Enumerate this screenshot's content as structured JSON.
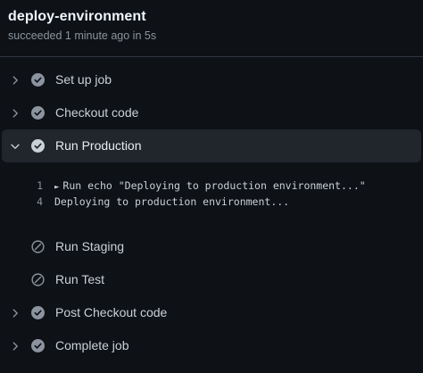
{
  "job": {
    "title": "deploy-environment",
    "status": "succeeded 1 minute ago in 5s"
  },
  "steps": [
    {
      "label": "Set up job",
      "state": "success",
      "expanded": false
    },
    {
      "label": "Checkout code",
      "state": "success",
      "expanded": false
    },
    {
      "label": "Run Production",
      "state": "success",
      "expanded": true
    },
    {
      "label": "Run Staging",
      "state": "skipped",
      "expanded": false
    },
    {
      "label": "Run Test",
      "state": "skipped",
      "expanded": false
    },
    {
      "label": "Post Checkout code",
      "state": "success",
      "expanded": false
    },
    {
      "label": "Complete job",
      "state": "success",
      "expanded": false
    }
  ],
  "log": {
    "lines": [
      {
        "number": "1",
        "group_marker": "►",
        "text": "Run echo \"Deploying to production environment...\""
      },
      {
        "number": "4",
        "text": "Deploying to production environment..."
      }
    ]
  },
  "colors": {
    "background": "#0e1116",
    "expanded_row": "#21262d",
    "success_icon": "#8b949e",
    "text": "#c9d1d9",
    "muted": "#8b949e"
  },
  "icons": {
    "collapsed": "chevron-right-icon",
    "expanded": "chevron-down-icon",
    "success": "check-circle-icon",
    "skipped": "skip-circle-icon"
  }
}
